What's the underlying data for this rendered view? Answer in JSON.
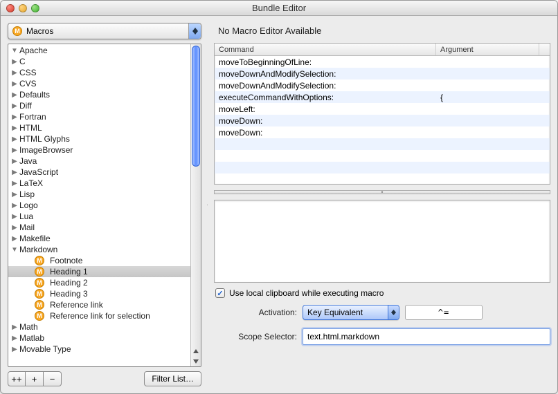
{
  "window": {
    "title": "Bundle Editor"
  },
  "popup": {
    "label": "Macros"
  },
  "tree": [
    {
      "label": "Apache",
      "expanded": true,
      "children": []
    },
    {
      "label": "C",
      "expanded": false
    },
    {
      "label": "CSS",
      "expanded": false
    },
    {
      "label": "CVS",
      "expanded": false
    },
    {
      "label": "Defaults",
      "expanded": false
    },
    {
      "label": "Diff",
      "expanded": false
    },
    {
      "label": "Fortran",
      "expanded": false
    },
    {
      "label": "HTML",
      "expanded": false
    },
    {
      "label": "HTML Glyphs",
      "expanded": false
    },
    {
      "label": "ImageBrowser",
      "expanded": false
    },
    {
      "label": "Java",
      "expanded": false
    },
    {
      "label": "JavaScript",
      "expanded": false
    },
    {
      "label": "LaTeX",
      "expanded": false
    },
    {
      "label": "Lisp",
      "expanded": false
    },
    {
      "label": "Logo",
      "expanded": false
    },
    {
      "label": "Lua",
      "expanded": false
    },
    {
      "label": "Mail",
      "expanded": false
    },
    {
      "label": "Makefile",
      "expanded": false
    },
    {
      "label": "Markdown",
      "expanded": true,
      "children": [
        {
          "label": "Footnote",
          "icon": "m"
        },
        {
          "label": "Heading 1",
          "icon": "m",
          "selected": true
        },
        {
          "label": "Heading 2",
          "icon": "m"
        },
        {
          "label": "Heading 3",
          "icon": "m"
        },
        {
          "label": "Reference link",
          "icon": "m"
        },
        {
          "label": "Reference link for selection",
          "icon": "m"
        }
      ]
    },
    {
      "label": "Math",
      "expanded": false
    },
    {
      "label": "Matlab",
      "expanded": false
    },
    {
      "label": "Movable Type",
      "expanded": false
    }
  ],
  "buttons": {
    "add_group": "++",
    "add": "+",
    "remove": "−",
    "filter": "Filter List…"
  },
  "detail": {
    "no_editor": "No Macro Editor Available",
    "columns": {
      "command": "Command",
      "argument": "Argument"
    },
    "rows": [
      {
        "cmd": "moveToBeginningOfLine:",
        "arg": ""
      },
      {
        "cmd": "moveDownAndModifySelection:",
        "arg": ""
      },
      {
        "cmd": "moveDownAndModifySelection:",
        "arg": ""
      },
      {
        "cmd": "executeCommandWithOptions:",
        "arg": "{"
      },
      {
        "cmd": "moveLeft:",
        "arg": ""
      },
      {
        "cmd": "moveDown:",
        "arg": ""
      },
      {
        "cmd": "moveDown:",
        "arg": ""
      },
      {
        "cmd": "",
        "arg": ""
      },
      {
        "cmd": "",
        "arg": ""
      },
      {
        "cmd": "",
        "arg": ""
      }
    ],
    "clipboard_label": "Use local clipboard while executing macro",
    "clipboard_checked": true,
    "activation_label": "Activation:",
    "activation_value": "Key Equivalent",
    "key_equivalent": "^=",
    "scope_label": "Scope Selector:",
    "scope_value": "text.html.markdown"
  }
}
